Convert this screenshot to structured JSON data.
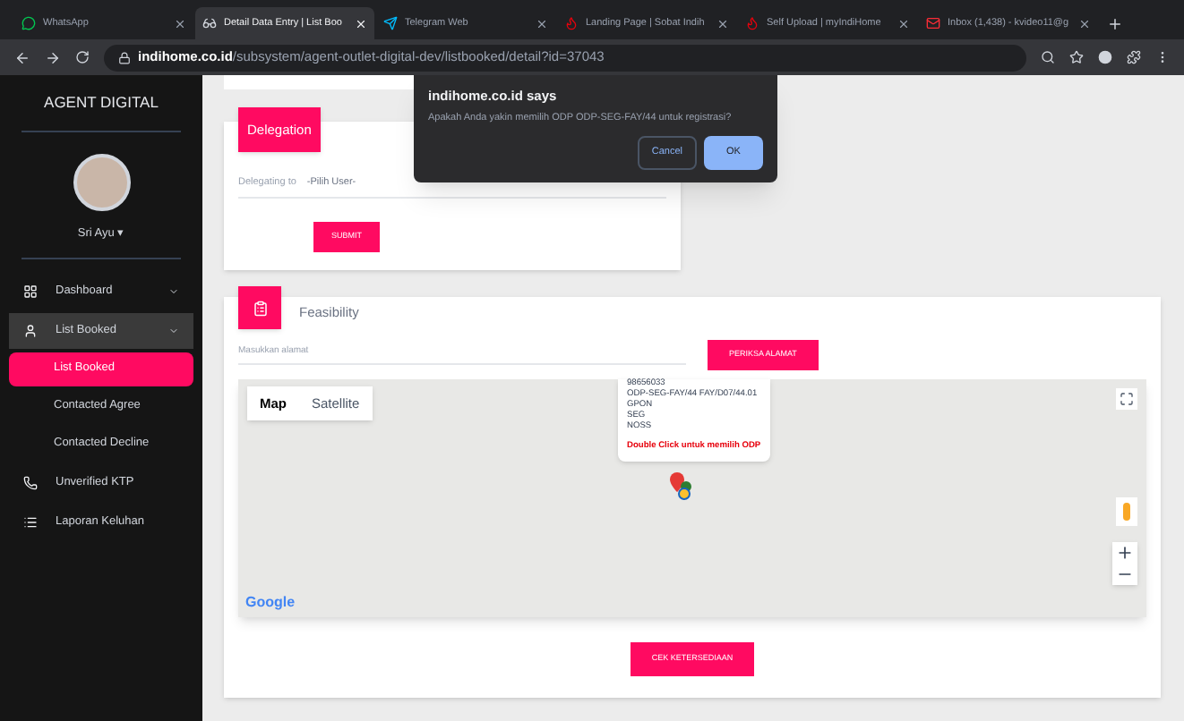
{
  "browser": {
    "tabs": [
      {
        "label": "WhatsApp",
        "selected": false
      },
      {
        "label": "Detail Data Entry | List Boo",
        "selected": true
      },
      {
        "label": "Telegram Web",
        "selected": false
      },
      {
        "label": "Landing Page | Sobat Indih",
        "selected": false
      },
      {
        "label": "Self Upload | myIndiHome",
        "selected": false
      },
      {
        "label": "Inbox (1,438) - kvideo11@g",
        "selected": false
      }
    ],
    "url_host": "indihome.co.id",
    "url_path": "/subsystem/agent-outlet-digital-dev/listbooked/detail?id=37043"
  },
  "sidebar": {
    "title": "AGENT DIGITAL",
    "user": "Sri Ayu ▾",
    "items": [
      {
        "label": "Dashboard",
        "expanded": false,
        "has_caret": true
      },
      {
        "label": "List Booked",
        "expanded": true,
        "has_caret": true,
        "children": [
          {
            "label": "List Booked",
            "selected": true
          },
          {
            "label": "Contacted Agree",
            "selected": false
          },
          {
            "label": "Contacted Decline",
            "selected": false
          }
        ]
      },
      {
        "label": "Unverified KTP",
        "expanded": false,
        "has_caret": false
      },
      {
        "label": "Laporan Keluhan",
        "expanded": false,
        "has_caret": false
      }
    ]
  },
  "delegation": {
    "title": "Delegation",
    "field_label": "Delegating to",
    "select_value": "-Pilih User-",
    "submit": "SUBMIT"
  },
  "feasibility": {
    "title": "Feasibility",
    "address_placeholder": "Masukkan alamat",
    "check_button": "PERIKSA ALAMAT",
    "map": {
      "tabs": [
        {
          "label": "Map",
          "selected": true
        },
        {
          "label": "Satellite",
          "selected": false
        }
      ],
      "info_lines": [
        "98656033",
        "ODP-SEG-FAY/44 FAY/D07/44.01",
        "GPON",
        "SEG",
        "NOSS"
      ],
      "info_action": "Double Click untuk memilih ODP",
      "logo": "Google"
    },
    "availability_button": "CEK KETERSEDIAAN"
  },
  "dialog": {
    "title": "indihome.co.id says",
    "message": "Apakah Anda yakin memilih ODP ODP-SEG-FAY/44 untuk registrasi?",
    "buttons": [
      {
        "label": "Cancel",
        "kind": "secondary"
      },
      {
        "label": "OK",
        "kind": "primary"
      }
    ]
  }
}
